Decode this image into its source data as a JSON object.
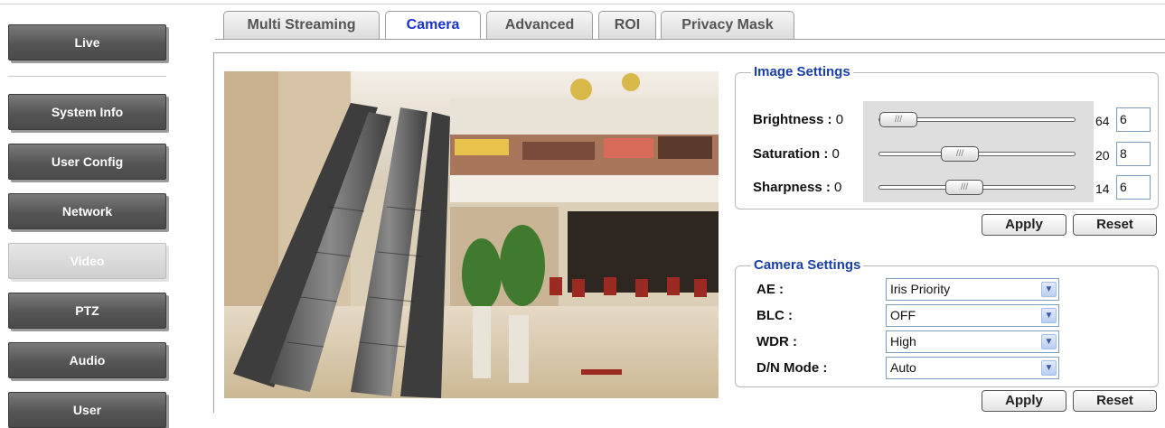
{
  "sidebar": {
    "items": [
      {
        "label": "Live"
      },
      {
        "label": "System Info"
      },
      {
        "label": "User Config"
      },
      {
        "label": "Network"
      },
      {
        "label": "Video"
      },
      {
        "label": "PTZ"
      },
      {
        "label": "Audio"
      },
      {
        "label": "User"
      }
    ],
    "active": "Video"
  },
  "tabs": [
    {
      "label": "Multi Streaming"
    },
    {
      "label": "Camera"
    },
    {
      "label": "Advanced"
    },
    {
      "label": "ROI"
    },
    {
      "label": "Privacy Mask"
    }
  ],
  "active_tab": "Camera",
  "image_settings": {
    "legend": "Image Settings",
    "sliders": [
      {
        "label": "Brightness :",
        "min": "0",
        "max": "64",
        "value": "6"
      },
      {
        "label": "Saturation :",
        "min": "0",
        "max": "20",
        "value": "8"
      },
      {
        "label": "Sharpness :",
        "min": "0",
        "max": "14",
        "value": "6"
      }
    ],
    "apply_label": "Apply",
    "reset_label": "Reset"
  },
  "camera_settings": {
    "legend": "Camera Settings",
    "fields": [
      {
        "label": "AE :",
        "value": "Iris Priority"
      },
      {
        "label": "BLC :",
        "value": "OFF"
      },
      {
        "label": "WDR :",
        "value": "High"
      },
      {
        "label": "D/N Mode :",
        "value": "Auto"
      }
    ],
    "apply_label": "Apply",
    "reset_label": "Reset"
  },
  "thumb_grip": "///",
  "colors": {
    "accent": "#1a40a8",
    "active_tab": "#1a33cc",
    "nav_button": "#555555"
  }
}
